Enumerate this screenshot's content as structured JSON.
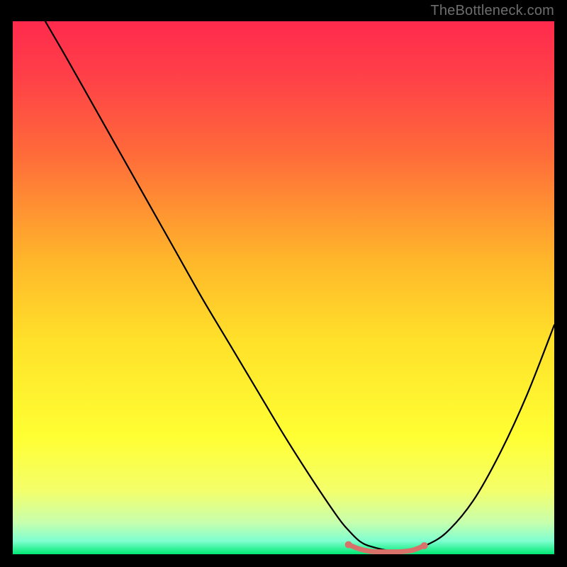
{
  "watermark": "TheBottleneck.com",
  "chart_data": {
    "type": "line",
    "title": "",
    "xlabel": "",
    "ylabel": "",
    "xlim": [
      0,
      100
    ],
    "ylim": [
      0,
      100
    ],
    "gradient_stops": [
      {
        "pos": 0.0,
        "color": "#ff2a4d"
      },
      {
        "pos": 0.1,
        "color": "#ff3f48"
      },
      {
        "pos": 0.25,
        "color": "#ff6b3a"
      },
      {
        "pos": 0.45,
        "color": "#ffb72a"
      },
      {
        "pos": 0.6,
        "color": "#ffe12a"
      },
      {
        "pos": 0.78,
        "color": "#ffff33"
      },
      {
        "pos": 0.88,
        "color": "#f4ff6a"
      },
      {
        "pos": 0.94,
        "color": "#c8ffad"
      },
      {
        "pos": 0.975,
        "color": "#7fffd0"
      },
      {
        "pos": 1.0,
        "color": "#00e874"
      }
    ],
    "series": [
      {
        "name": "bottleneck-curve",
        "stroke": "#000000",
        "x": [
          6,
          10,
          15,
          20,
          25,
          30,
          35,
          40,
          45,
          50,
          55,
          60,
          62,
          64,
          66,
          70,
          74,
          76,
          80,
          85,
          90,
          95,
          100
        ],
        "values": [
          100,
          93,
          84,
          75,
          66,
          57,
          48,
          39.5,
          31,
          22.5,
          14.5,
          7,
          4.5,
          2.5,
          1.5,
          0.6,
          0.6,
          1.5,
          4,
          10,
          19,
          30,
          43
        ]
      },
      {
        "name": "optimal-band",
        "stroke": "#d9716b",
        "x": [
          62,
          64,
          66,
          68,
          70,
          72,
          74,
          76
        ],
        "values": [
          1.8,
          1.0,
          0.55,
          0.45,
          0.45,
          0.5,
          0.8,
          1.6
        ]
      }
    ],
    "optimal_band_endpoints": {
      "left": {
        "x": 62,
        "y": 1.8
      },
      "right": {
        "x": 76,
        "y": 1.6
      }
    }
  }
}
